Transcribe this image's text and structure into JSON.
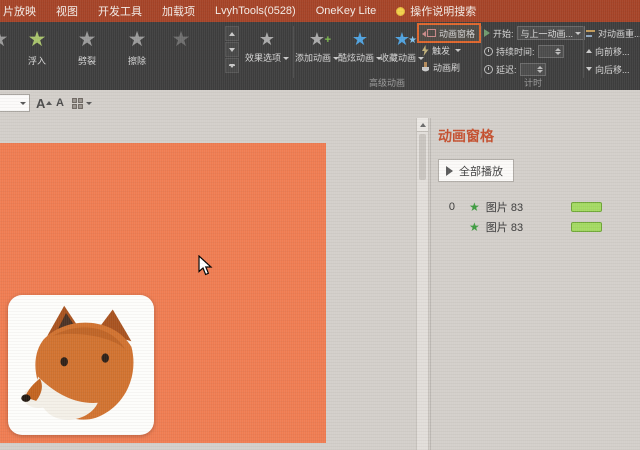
{
  "menubar": {
    "items": [
      "片放映",
      "视图",
      "开发工具",
      "加载项",
      "LvyhTools(0528)",
      "OneKey Lite",
      "操作说明搜索"
    ]
  },
  "ribbon": {
    "gallery": {
      "items": [
        {
          "label": ""
        },
        {
          "label": "浮入"
        },
        {
          "label": "劈裂"
        },
        {
          "label": "擦除"
        },
        {
          "label": ""
        }
      ]
    },
    "effect_options": "效果选项",
    "add_animation": "添加动画",
    "cool_animation": "酷炫动画",
    "favorite_animation": "收藏动画",
    "animation_pane_button": "动画窗格",
    "trigger": "触发",
    "animation_painter": "动画刷",
    "advanced_group_label": "高级动画",
    "timing": {
      "start_label": "开始:",
      "start_value": "与上一动画...",
      "duration_label": "持续时间:",
      "delay_label": "延迟:",
      "group_label": "计时"
    },
    "reorder": {
      "title": "对动画重...",
      "move_earlier": "向前移...",
      "move_later": "向后移..."
    }
  },
  "pane": {
    "title": "动画窗格",
    "play_all_label": "全部播放",
    "items": [
      {
        "index": "0",
        "label": "图片 83"
      },
      {
        "index": "",
        "label": "图片 83"
      }
    ]
  },
  "colors": {
    "menubar_bg": "#A54327",
    "ribbon_bg": "#3D3D3D",
    "slide_orange": "#EF7C51",
    "pane_title_red": "#C5502F",
    "timeline_bar_green": "#A4DA62",
    "highlight_orange": "#E0662C"
  }
}
